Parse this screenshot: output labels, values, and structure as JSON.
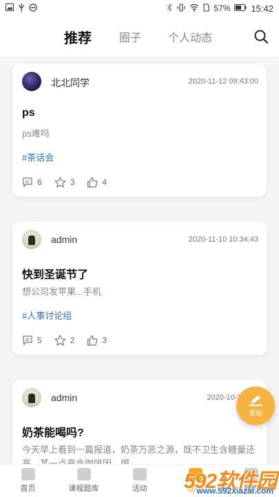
{
  "status_bar": {
    "battery": "57%",
    "time": "15:42"
  },
  "header": {
    "tabs": [
      {
        "label": "推荐",
        "active": true
      },
      {
        "label": "圈子",
        "active": false
      },
      {
        "label": "个人动态",
        "active": false
      }
    ],
    "search_icon": "search-icon"
  },
  "posts": [
    {
      "username": "北北同学",
      "timestamp": "2020-11-12 09:43:00",
      "title": "ps",
      "excerpt": "ps难吗",
      "tag": "#茶话会",
      "comments": "6",
      "likes": "3",
      "thumbs": "4"
    },
    {
      "username": "admin",
      "timestamp": "2020-11-10 10:34:43",
      "title": "快到圣诞节了",
      "excerpt": "想公司发苹果...手机",
      "tag": "#人事讨论组",
      "comments": "5",
      "likes": "2",
      "thumbs": "3"
    },
    {
      "username": "admin",
      "timestamp": "2020-10-27 14:",
      "title": "奶茶能喝吗?",
      "excerpt": "今天早上看到一篇报道，奶茶万恶之源，既不卫生含糖量还高，某一点高含咖啡因，喝"
    }
  ],
  "fab": {
    "label": "发帖"
  },
  "bottom_nav": [
    {
      "label": "首页"
    },
    {
      "label": "课程题库"
    },
    {
      "label": "活动"
    },
    {
      "label": "圈子"
    },
    {
      "label": "我的"
    }
  ],
  "watermark": {
    "main": "592软件园",
    "sub": "www.592xiazai.com"
  },
  "colors": {
    "accent": "#f5b342",
    "tag": "#2f6fb8"
  }
}
